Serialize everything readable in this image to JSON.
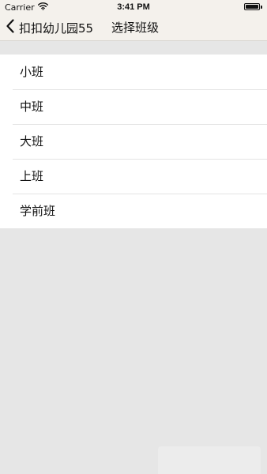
{
  "status_bar": {
    "carrier": "Carrier",
    "time": "3:41 PM",
    "icons": [
      "wifi-icon",
      "battery-icon"
    ]
  },
  "nav": {
    "back_label": "扣扣幼儿园55",
    "back_icon": "chevron-left-icon",
    "title": "选择班级"
  },
  "classes": [
    {
      "label": "小班"
    },
    {
      "label": "中班"
    },
    {
      "label": "大班"
    },
    {
      "label": "上班"
    },
    {
      "label": "学前班"
    }
  ],
  "colors": {
    "bar_background": "#f4f1ec",
    "page_background": "#e6e6e6",
    "list_background": "#ffffff",
    "separator": "#e4e4e4",
    "text": "#111111"
  }
}
